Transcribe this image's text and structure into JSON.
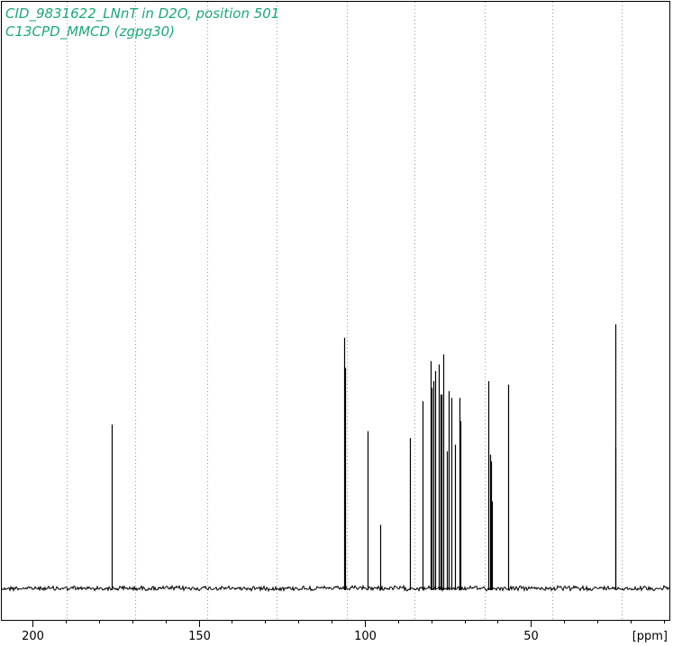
{
  "chart_data": {
    "type": "line",
    "title": "CID_9831622_LNnT in D2O, position 501",
    "subtitle": "C13CPD_MMCD (zgpg30)",
    "xlabel": "[ppm]",
    "ylabel": "",
    "x_reversed": true,
    "xlim": [
      209.3,
      8.3
    ],
    "ylim": [
      0,
      1
    ],
    "x_ticks": [
      200,
      150,
      100,
      50
    ],
    "x_ticks_minor": [
      190,
      180,
      170,
      160,
      140,
      130,
      120,
      110,
      90,
      80,
      70,
      60,
      40,
      30,
      20,
      10
    ],
    "grid": "vertical dotted at 10 ppm intervals",
    "grid_lines": [
      189.7,
      169.1,
      147.4,
      126.6,
      105.3,
      85.2,
      63.8,
      43.6,
      22.8
    ],
    "colors": {
      "title": "#1aa879",
      "spectrum": "#000000",
      "grid": "#9a9a9a"
    },
    "series": [
      {
        "values": [
          {
            "x": 176.1,
            "height": 0.49
          },
          {
            "x": 106.2,
            "height": 0.75
          },
          {
            "x": 106.0,
            "height": 0.66
          },
          {
            "x": 99.1,
            "height": 0.47
          },
          {
            "x": 95.4,
            "height": 0.19
          },
          {
            "x": 86.3,
            "height": 0.45
          },
          {
            "x": 82.7,
            "height": 0.56
          },
          {
            "x": 80.2,
            "height": 0.68
          },
          {
            "x": 79.9,
            "height": 0.6
          },
          {
            "x": 79.5,
            "height": 0.62
          },
          {
            "x": 78.7,
            "height": 0.65
          },
          {
            "x": 77.7,
            "height": 0.67
          },
          {
            "x": 77.3,
            "height": 0.58
          },
          {
            "x": 77.0,
            "height": 0.58
          },
          {
            "x": 76.4,
            "height": 0.7
          },
          {
            "x": 75.3,
            "height": 0.41
          },
          {
            "x": 74.7,
            "height": 0.59
          },
          {
            "x": 73.9,
            "height": 0.57
          },
          {
            "x": 72.9,
            "height": 0.43
          },
          {
            "x": 71.6,
            "height": 0.57
          },
          {
            "x": 71.2,
            "height": 0.5
          },
          {
            "x": 62.8,
            "height": 0.62
          },
          {
            "x": 62.4,
            "height": 0.4
          },
          {
            "x": 62.0,
            "height": 0.38
          },
          {
            "x": 61.7,
            "height": 0.26
          },
          {
            "x": 56.8,
            "height": 0.61
          },
          {
            "x": 24.7,
            "height": 0.79
          },
          {
            "x": 24.5,
            "height": 0.42
          }
        ]
      }
    ]
  }
}
